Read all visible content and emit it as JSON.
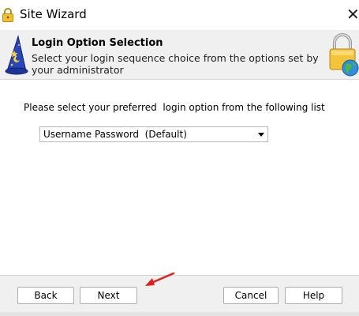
{
  "window": {
    "title": "Site Wizard",
    "close_glyph": "✕"
  },
  "header": {
    "title": "Login Option Selection",
    "subtitle": "Select your login sequence choice from the options set by your administrator"
  },
  "content": {
    "prompt": "Please select your preferred  login option from the following list",
    "login_option": {
      "selected": "Username Password  (Default)"
    }
  },
  "footer": {
    "back_label": "Back",
    "next_label": "Next",
    "cancel_label": "Cancel",
    "help_label": "Help"
  },
  "icons": {
    "title": "padlock-icon",
    "header_left": "wizard-hat-icon",
    "header_right": "padlock-globe-icon",
    "annotation": "red-arrow"
  },
  "colors": {
    "header_bg": "#f0f0f0",
    "footer_bg": "#f0f0f0",
    "annotation_arrow": "#e02020"
  }
}
